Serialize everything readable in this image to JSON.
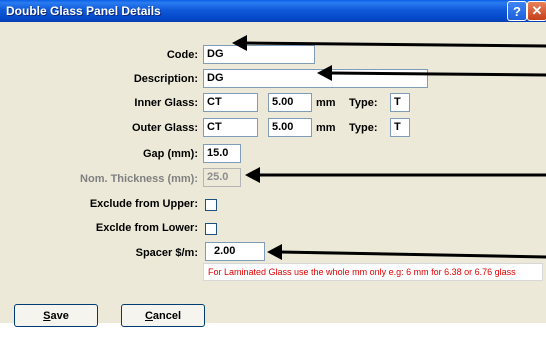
{
  "window": {
    "title": "Double Glass Panel Details",
    "help_glyph": "?",
    "close_glyph": "✕"
  },
  "form": {
    "code": {
      "label": "Code:",
      "value": "DG"
    },
    "description": {
      "label": "Description:",
      "value": "DG"
    },
    "inner_glass": {
      "label": "Inner Glass:",
      "value": "CT",
      "thickness": "5.00",
      "unit": "mm",
      "type_label": "Type:",
      "type_value": "T"
    },
    "outer_glass": {
      "label": "Outer Glass:",
      "value": "CT",
      "thickness": "5.00",
      "unit": "mm",
      "type_label": "Type:",
      "type_value": "T"
    },
    "gap": {
      "label": "Gap (mm):",
      "value": "15.0"
    },
    "nom_thickness": {
      "label": "Nom. Thickness (mm):",
      "value": "25.0"
    },
    "exclude_upper": {
      "label": "Exclude from Upper:",
      "checked": false
    },
    "exclude_lower": {
      "label": "Exclde from Lower:",
      "checked": false
    },
    "spacer": {
      "label": "Spacer $/m:",
      "value": "2.00"
    },
    "hint": "For Laminated Glass use the whole mm only e.g: 6 mm for 6.38 or 6.76 glass"
  },
  "buttons": {
    "save": {
      "accel": "S",
      "rest": "ave"
    },
    "cancel": {
      "accel": "C",
      "rest": "ancel"
    }
  },
  "colors": {
    "titlebar": "#0447c8",
    "dialog_bg": "#ece9d8",
    "hint_text": "#e00000",
    "arrow": "#000000"
  }
}
